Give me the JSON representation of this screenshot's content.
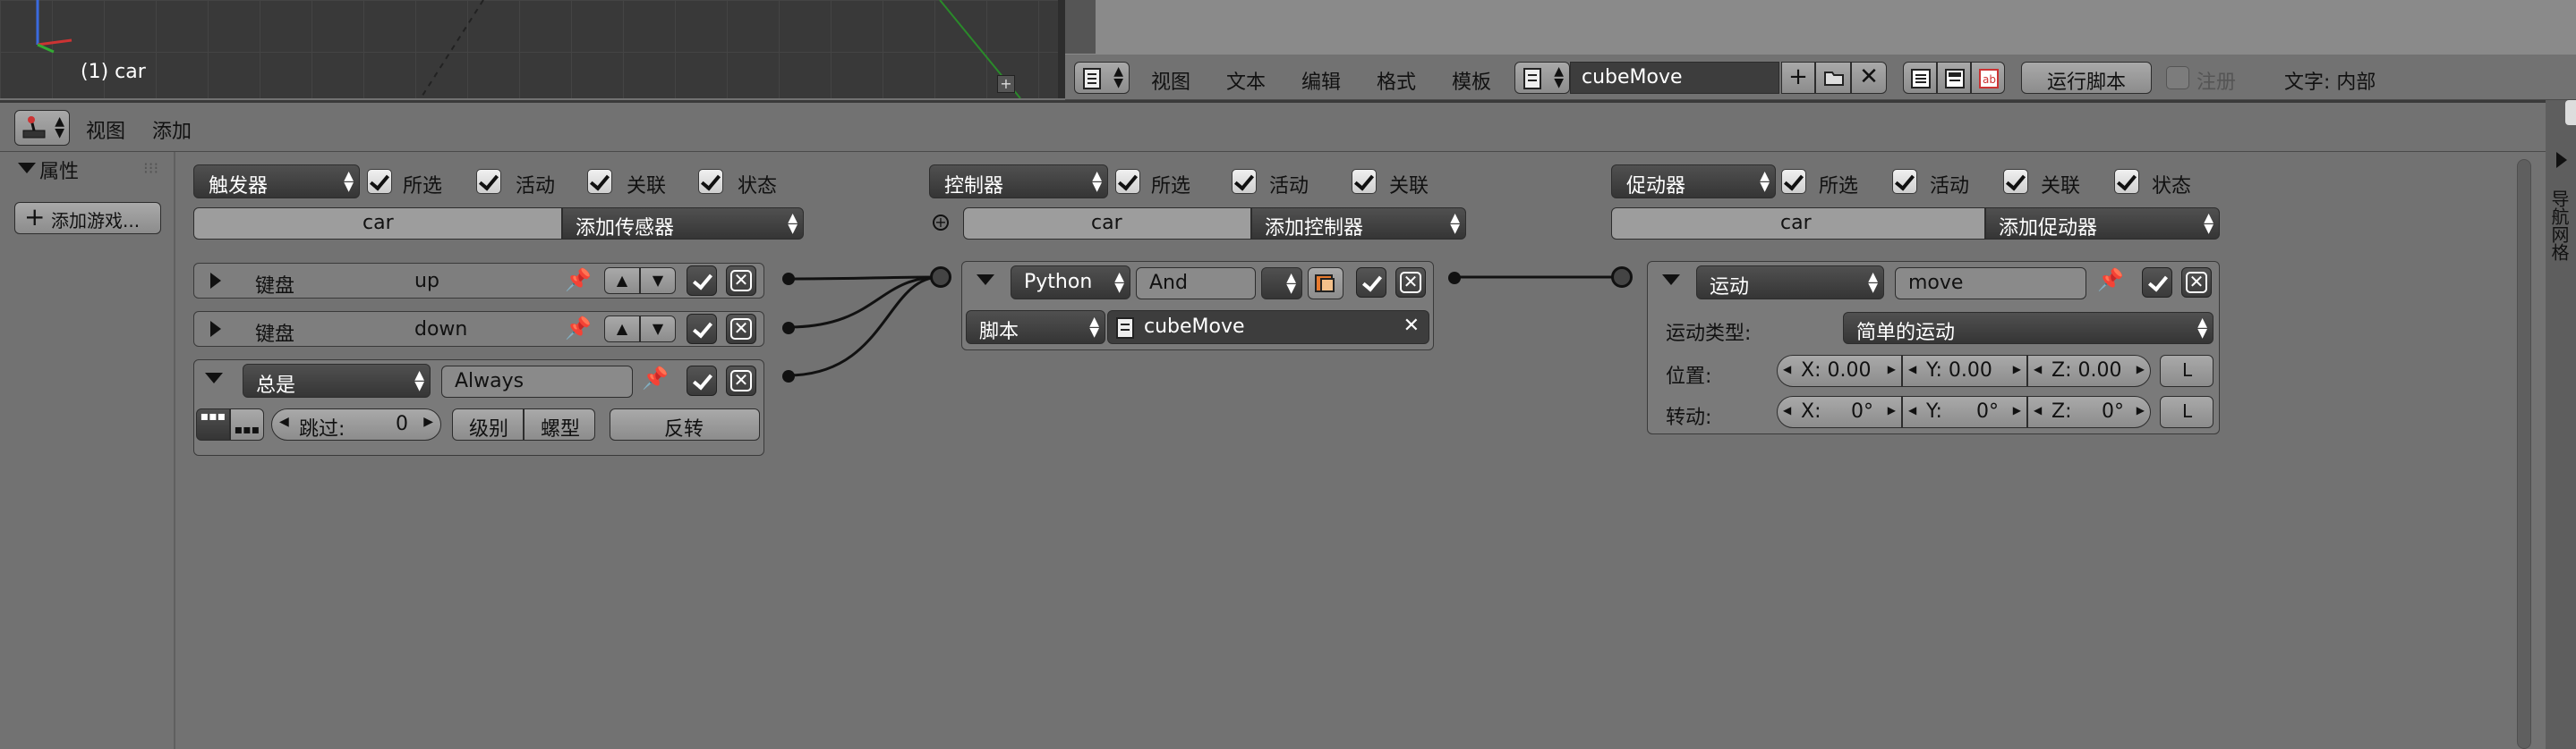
{
  "viewport": {
    "object_label": "(1) car"
  },
  "text_editor": {
    "menu": [
      "视图",
      "文本",
      "编辑",
      "格式",
      "模板"
    ],
    "script_name": "cubeMove",
    "run_script": "运行脚本",
    "register": "注册",
    "text_source": "文字: 内部"
  },
  "logic_editor": {
    "menu": [
      "视图",
      "添加"
    ],
    "properties_title": "属性",
    "add_game_property": "添加游戏..."
  },
  "sensors": {
    "column_label": "触发器",
    "filters": [
      "所选",
      "活动",
      "关联",
      "状态"
    ],
    "object": "car",
    "add_label": "添加传感器",
    "items": [
      {
        "type": "键盘",
        "key": "up"
      },
      {
        "type": "键盘",
        "key": "down"
      }
    ],
    "always": {
      "type": "总是",
      "name": "Always",
      "skip_label": "跳过:",
      "skip_value": "0",
      "level": "级别",
      "tap": "螺型",
      "invert": "反转"
    }
  },
  "controllers": {
    "column_label": "控制器",
    "filters": [
      "所选",
      "活动",
      "关联"
    ],
    "object": "car",
    "add_label": "添加控制器",
    "item": {
      "type": "Python",
      "name": "And",
      "mode": "脚本",
      "script": "cubeMove"
    }
  },
  "actuators": {
    "column_label": "促动器",
    "filters": [
      "所选",
      "活动",
      "关联",
      "状态"
    ],
    "object": "car",
    "add_label": "添加促动器",
    "item": {
      "type": "运动",
      "name": "move",
      "motion_type_label": "运动类型:",
      "motion_type": "简单的运动",
      "loc_label": "位置:",
      "loc": [
        "X: 0.00",
        "Y: 0.00",
        "Z: 0.00"
      ],
      "rot_label": "转动:",
      "rot_x_label": "X:",
      "rot_x_val": "0°",
      "rot_y_label": "Y:",
      "rot_y_val": "0°",
      "rot_z_label": "Z:",
      "rot_z_val": "0°",
      "local": "L"
    }
  },
  "sidebar_right": {
    "label": "导航网格"
  }
}
